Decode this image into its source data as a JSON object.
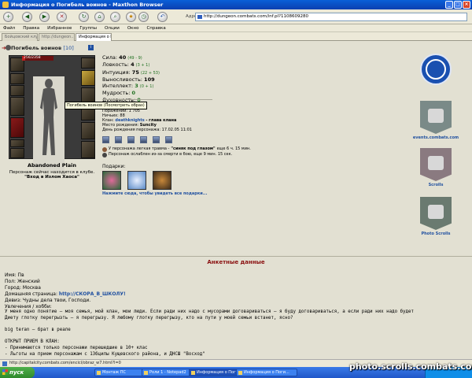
{
  "window": {
    "title": "Информация о Погибель воинов - Maxthon Browser"
  },
  "toolbar": {
    "address_label": "Адрес",
    "url": "http://dungeon.combats.com/inf.pl?1108609280"
  },
  "menu": [
    "Файл",
    "Правка",
    "Избранное",
    "Группы",
    "Опции",
    "Окно",
    "Справка"
  ],
  "tabs": [
    {
      "label": "Бойцовский клуб",
      "active": false
    },
    {
      "label": "http://dungeon...",
      "active": false
    },
    {
      "label": "Информация о П",
      "active": true
    }
  ],
  "character": {
    "name": "Погибель воинов",
    "level": "[10]",
    "hp": "256/2358",
    "tooltip": "Погибель воинов (Посмотреть образ)",
    "location_name": "Abandoned Plain",
    "status": "Персонаж сейчас находится в клубе.",
    "place": "\"Вход в Излом Хаоса\""
  },
  "stats": [
    {
      "label": "Сила:",
      "value": "40",
      "extra": "(49 - 9)"
    },
    {
      "label": "Ловкость:",
      "value": "4",
      "extra": "(3 + 1)"
    },
    {
      "label": "Интуиция:",
      "value": "75",
      "extra": "(22 + 53)"
    },
    {
      "label": "Выносливость:",
      "value": "109",
      "extra": ""
    },
    {
      "label": "Интеллект:",
      "value": "3",
      "extra": "(0 + 1)"
    },
    {
      "label": "Мудрость:",
      "value": "0",
      "extra": ""
    },
    {
      "label": "Духовность:",
      "value": "0",
      "extra": ""
    }
  ],
  "info": {
    "losses": "Поражений: 1 705",
    "draws": "Ничьих: 88",
    "clan_label": "Клан:",
    "clan": "deathknights",
    "clan_role": "- глава клана",
    "birthplace_label": "Место рождения:",
    "birthplace": "Suncity",
    "birthday": "День рождения персонажа: 17.02.05 11:01"
  },
  "trauma": {
    "line1_prefix": "У персонажа легкая травма -",
    "line1_name": "\"синяк под глазом\"",
    "line1_suffix": "еще 6 ч. 15 мин.",
    "line2": "Персонаж ослаблен из-за смерти в бою, еще 9 мин. 15 сек."
  },
  "gifts": {
    "title": "Подарки:",
    "link": "Нажмите сюда, чтобы увидеть все подарки..."
  },
  "side": [
    {
      "label": "events.combats.com"
    },
    {
      "label": "Scrolls"
    },
    {
      "label": "Photo Scrolls"
    }
  ],
  "anketa": {
    "title": "Анкетные данные",
    "name": "Имя: Пв",
    "gender": "Пол: Женский",
    "city": "Город: Москва",
    "homepage_label": "Домашняя страница:",
    "homepage": "http://СКОРА_В_ШКОЛУ!",
    "motto": "Девиз: Чудны дела твои, Господи.",
    "hobbies": "Увлечения / хобби:",
    "about1": "У меня одно понятие – моя семья, мой клан, мои люди. Если ради них надо с мусорами договариваться – я буду договариваться, а если ради них надо будет",
    "about2": "Диету глотку перегрызть – я перегрызу. Я любому глотку перегрызу, кто на пути у моей семьи встанет, ясно?",
    "brother": "big teran – брат в реале",
    "recruit": "ОТКРЫТ ПРИЕМ В КЛАН:",
    "rule1": "- Принимаются только персонажи перешедшие в 10+ клас",
    "rule2": "- Льготы на прием персонажам с 13бцилы Кущевского района, и ДНСШ \"Восход\""
  },
  "status_url": "http://capitalcity.combats.com/encicl/obraz_w7.html?l=0",
  "taskbar": {
    "start": "пуск",
    "tasks": [
      {
        "label": "Монтаж ПС",
        "active": false
      },
      {
        "label": "Роли 1 - Notepad2",
        "active": false
      },
      {
        "label": "Информация о Поги...",
        "active": true
      },
      {
        "label": "Информация о Поги...",
        "active": false
      }
    ]
  },
  "watermark": "photo.scrolls.combats.com"
}
